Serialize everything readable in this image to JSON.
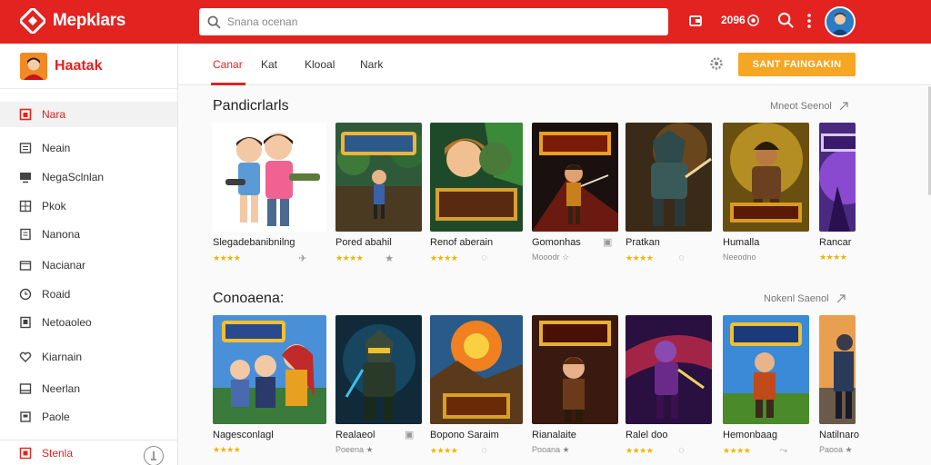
{
  "app": {
    "logo_text": "Mepklars",
    "search_placeholder": "Snana ocenan",
    "coins": "2096",
    "colors": {
      "brand": "#e2231f",
      "cta": "#f5a623",
      "star": "#f5b301"
    }
  },
  "sidebar": {
    "title": "Haatak",
    "items": [
      {
        "label": "Nara",
        "icon": "home-icon",
        "active": true
      },
      {
        "label": "Neain",
        "icon": "list-icon"
      },
      {
        "label": "NegaSclnlan",
        "icon": "monitor-icon"
      },
      {
        "label": "Pkok",
        "icon": "grid-icon"
      },
      {
        "label": "Nanona",
        "icon": "document-icon"
      },
      {
        "label": "Nacianar",
        "icon": "folder-icon"
      },
      {
        "label": "Roaid",
        "icon": "clock-icon"
      },
      {
        "label": "Netoaoleo",
        "icon": "tablet-icon"
      },
      {
        "label": "Kiarnain",
        "icon": "heart-icon"
      },
      {
        "label": "Neerlan",
        "icon": "inbox-icon"
      },
      {
        "label": "Paole",
        "icon": "box-icon"
      }
    ],
    "bottom_label": "Stenla",
    "bottom_icon": "info-icon"
  },
  "tabs": {
    "items": [
      "Canar",
      "Kat",
      "Klooal",
      "Nark"
    ],
    "active": 0,
    "cta_label": "SANT FAINGAKIN"
  },
  "sections": [
    {
      "title": "Pandicrlarls",
      "more": "Mneot Seenol",
      "cards": [
        {
          "name": "Slegadebanibnilng",
          "stars": "★★★★",
          "meta": "",
          "icon": "pin-icon"
        },
        {
          "name": "Pored abahil",
          "stars": "★★★★",
          "meta": "",
          "icon": "star-icon"
        },
        {
          "name": "Renof aberain",
          "stars": "★★★★",
          "meta": "",
          "icon": "chat-icon"
        },
        {
          "name": "Gomonhas",
          "stars": "",
          "meta": "Mooodr ☆",
          "icon": "box-icon"
        },
        {
          "name": "Pratkan",
          "stars": "★★★★",
          "meta": "",
          "icon": "chat-icon"
        },
        {
          "name": "Humalla",
          "stars": "",
          "meta": "Neeodno",
          "icon": ""
        },
        {
          "name": "Rancar",
          "stars": "★★★★",
          "meta": "",
          "icon": ""
        }
      ]
    },
    {
      "title": "Conoaena:",
      "more": "Nokenl Saenol",
      "cards": [
        {
          "name": "Nagesconlagl",
          "stars": "★★★★",
          "meta": "",
          "icon": ""
        },
        {
          "name": "Realaeol",
          "stars": "",
          "meta": "Poeena ★",
          "icon": "box-icon"
        },
        {
          "name": "Bopono Saraim",
          "stars": "★★★★",
          "meta": "",
          "icon": "chat-icon"
        },
        {
          "name": "Rianalaite",
          "stars": "",
          "meta": "Pooana ★",
          "icon": ""
        },
        {
          "name": "Ralel doo",
          "stars": "★★★★",
          "meta": "",
          "icon": "chat-icon"
        },
        {
          "name": "Hemonbaag",
          "stars": "★★★★",
          "meta": "",
          "icon": "share-icon"
        },
        {
          "name": "Natilnaro",
          "stars": "",
          "meta": "Paooa ★",
          "icon": ""
        }
      ]
    }
  ]
}
